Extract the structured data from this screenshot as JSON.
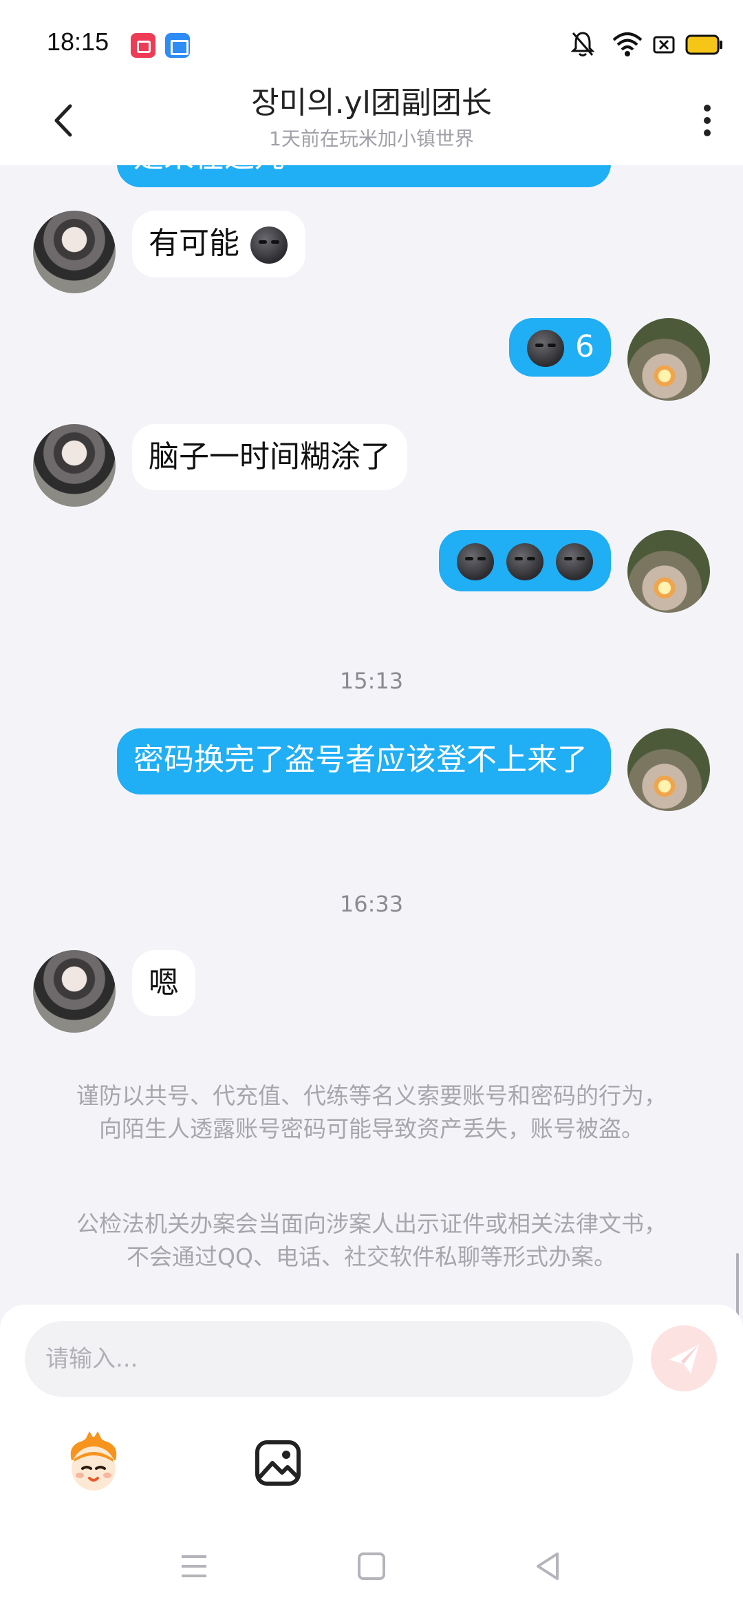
{
  "status_bar": {
    "time": "18:15"
  },
  "header": {
    "title": "장미의.yl团副团长",
    "subtitle": "1天前在玩米加小镇世界"
  },
  "messages": {
    "partial_out": "是来在这儿",
    "msg1": {
      "text": "有可能"
    },
    "msg2": {
      "text": "6"
    },
    "msg3": {
      "text": "脑子一时间糊涂了"
    },
    "time1": "15:13",
    "msg5": {
      "text": "密码换完了盗号者应该登不上来了"
    },
    "time2": "16:33",
    "msg6": {
      "text": "嗯"
    }
  },
  "notices": {
    "notice1": "谨防以共号、代充值、代练等名义索要账号和密码的行为，向陌生人透露账号密码可能导致资产丢失，账号被盗。",
    "notice2": "公检法机关办案会当面向涉案人出示证件或相关法律文书，不会通过QQ、电话、社交软件私聊等形式办案。"
  },
  "input": {
    "placeholder": "请输入..."
  },
  "icons": {
    "emoji": "dark-moon-face-emoji",
    "send": "paper-plane-icon",
    "sticker": "cartoon-sticker-icon",
    "image": "image-icon"
  },
  "colors": {
    "outgoing_bubble": "#20aef5",
    "incoming_bubble": "#ffffff",
    "background": "#f4f4f8",
    "send_button": "#fde2e2"
  }
}
